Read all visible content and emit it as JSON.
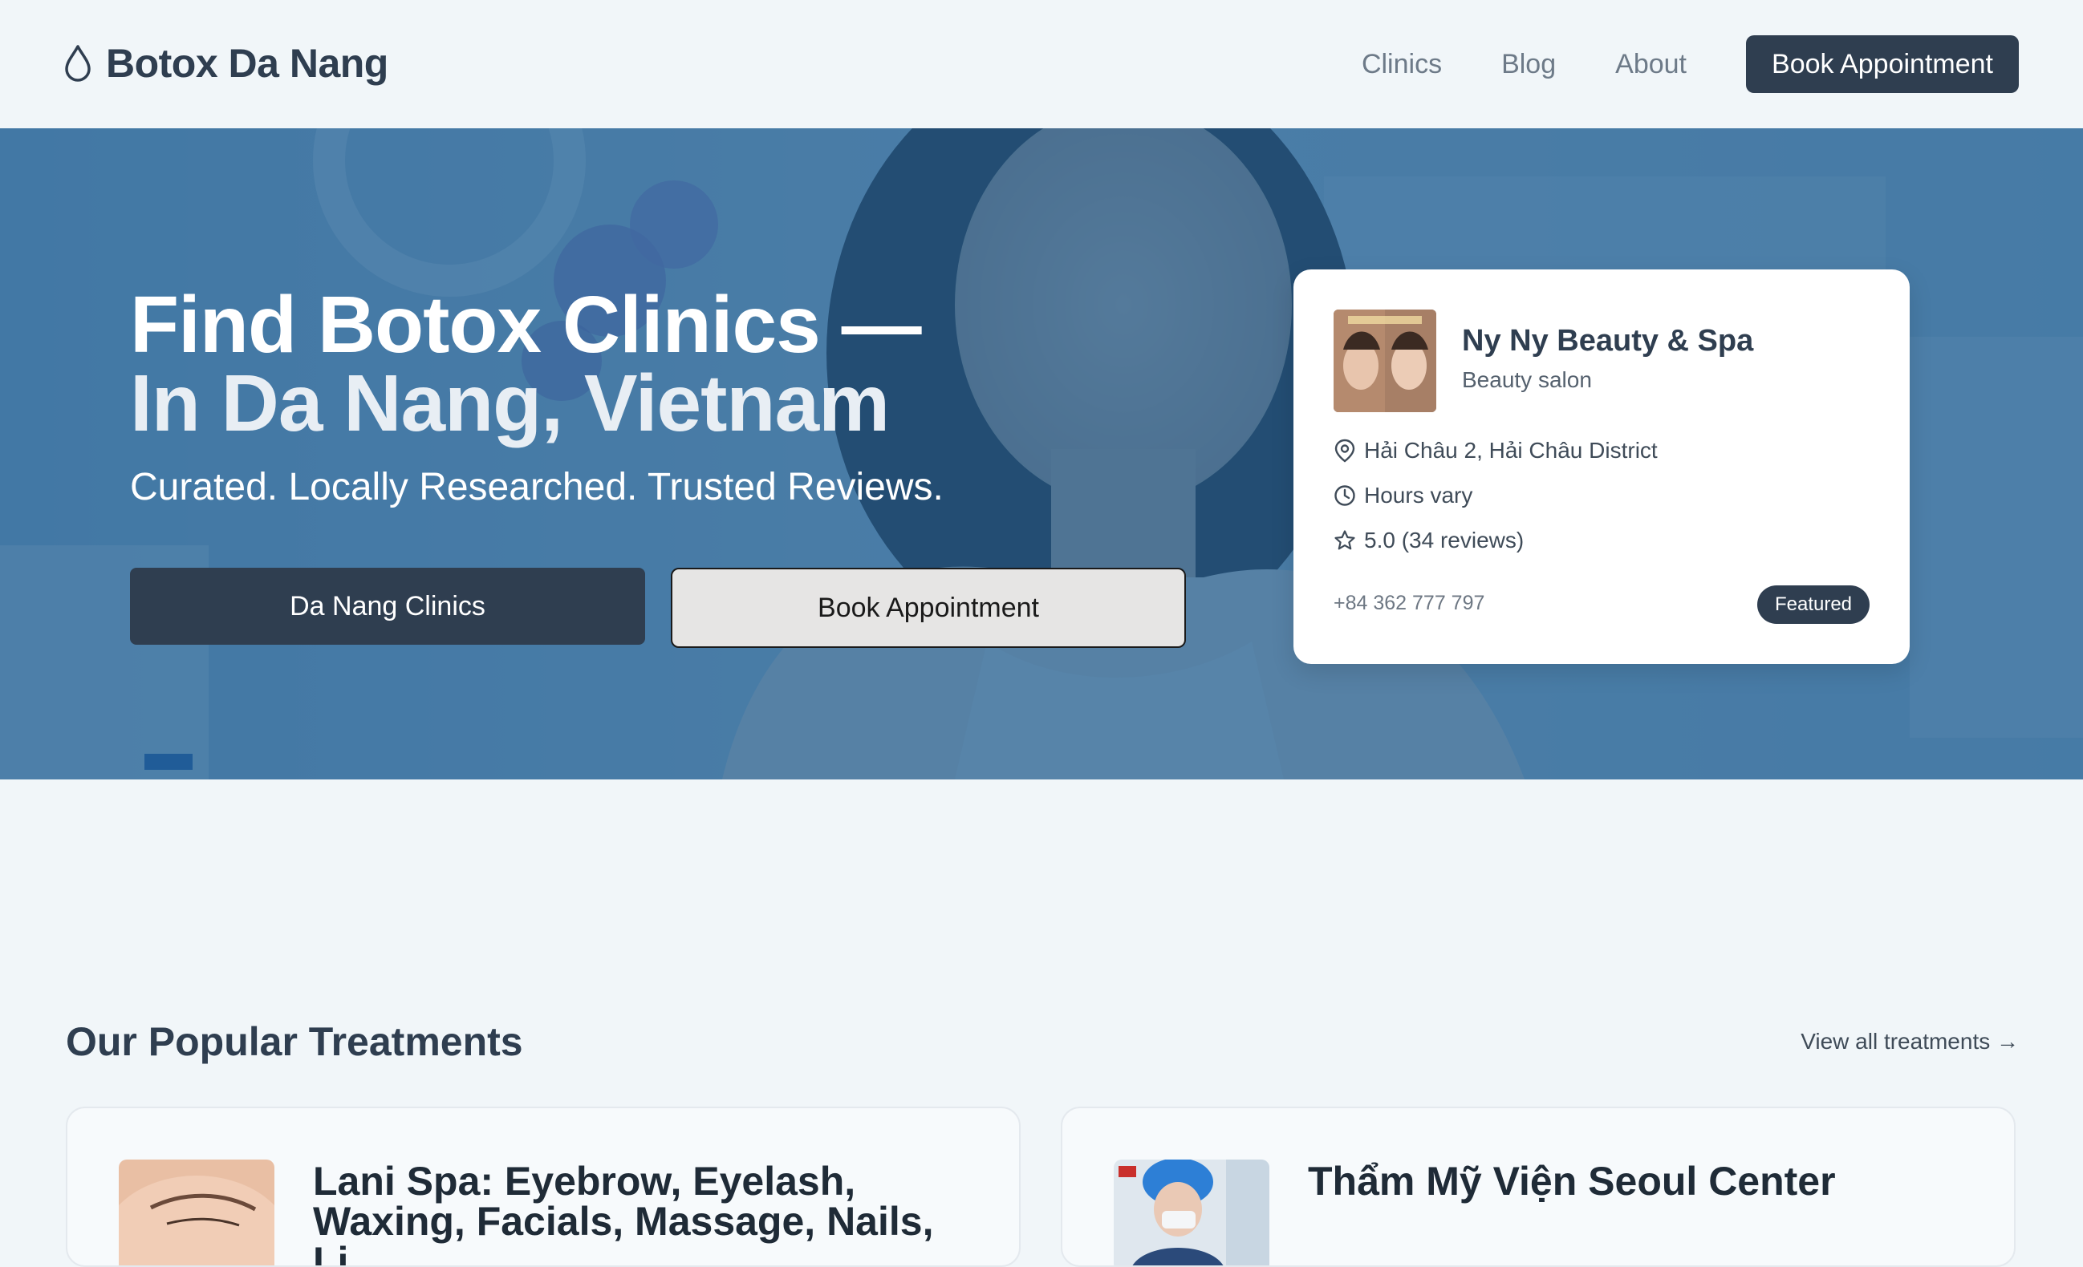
{
  "brand": {
    "name": "Botox Da Nang",
    "icon": "droplet-icon"
  },
  "nav": {
    "links": [
      "Clinics",
      "Blog",
      "About"
    ],
    "cta": "Book Appointment"
  },
  "hero": {
    "title_line1": "Find Botox Clinics —",
    "title_line2": "In Da Nang, Vietnam",
    "subtitle": "Curated. Locally Researched. Trusted Reviews.",
    "primary_button": "Da Nang Clinics",
    "secondary_button": "Book Appointment"
  },
  "featured_clinic": {
    "name": "Ny Ny Beauty & Spa",
    "type": "Beauty salon",
    "address": "Hải Châu 2, Hải Châu District",
    "hours": "Hours vary",
    "rating": "5.0 (34 reviews)",
    "phone": "+84 362 777 797",
    "badge": "Featured"
  },
  "treatments": {
    "title": "Our Popular Treatments",
    "view_all": "View all treatments →",
    "items": [
      {
        "title": "Lani Spa: Eyebrow, Eyelash, Waxing, Facials, Massage, Nails, Li"
      },
      {
        "title": "Thẩm Mỹ Viện Seoul Center"
      }
    ]
  },
  "colors": {
    "primary": "#2f3e50",
    "hero_overlay": "#1a5c92",
    "background": "#f1f6f9"
  }
}
